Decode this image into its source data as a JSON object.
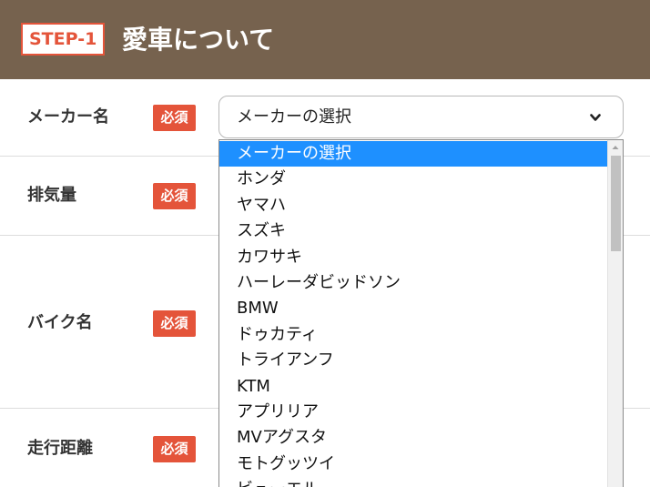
{
  "header": {
    "step": "STEP-1",
    "title": "愛車について"
  },
  "rows": {
    "maker": {
      "label": "メーカー名",
      "required": "必須"
    },
    "displacement": {
      "label": "排気量",
      "required": "必須"
    },
    "bike_name": {
      "label": "バイク名",
      "required": "必須"
    },
    "mileage": {
      "label": "走行距離",
      "required": "必須"
    }
  },
  "maker_select": {
    "value": "メーカーの選択",
    "icon": "chevron-down-icon",
    "options": [
      "メーカーの選択",
      "ホンダ",
      "ヤマハ",
      "スズキ",
      "カワサキ",
      "ハーレーダビッドソン",
      "BMW",
      "ドゥカティ",
      "トライアンフ",
      "KTM",
      "アプリリア",
      "MVアグスタ",
      "モトグッツイ",
      "ビューエル"
    ],
    "highlighted": "メーカーの選択"
  },
  "colors": {
    "header_bg": "#76624e",
    "accent": "#e4543a",
    "highlight": "#1e90ff"
  }
}
